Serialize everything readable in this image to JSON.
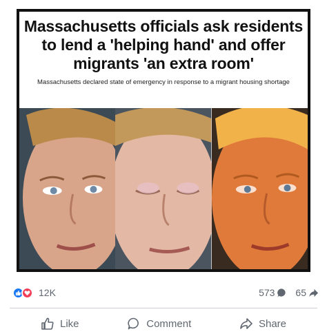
{
  "post": {
    "headline": "Massachusetts officials ask residents to lend a 'helping hand' and offer migrants 'an extra room'",
    "subheadline": "Massachusetts declared state of emergency in response to a migrant housing shortage",
    "meme_icon_names": [
      "face-neutral-panel",
      "face-eyes-closed-panel",
      "face-glowing-panel"
    ]
  },
  "engagement": {
    "reaction_count": "12K",
    "comment_count": "573",
    "share_count": "65",
    "reaction_icons": [
      "like-icon",
      "love-icon"
    ],
    "colors": {
      "like": "#1877f2",
      "love": "#f33e58",
      "text": "#606770"
    }
  },
  "actions": {
    "like_label": "Like",
    "comment_label": "Comment",
    "share_label": "Share"
  }
}
